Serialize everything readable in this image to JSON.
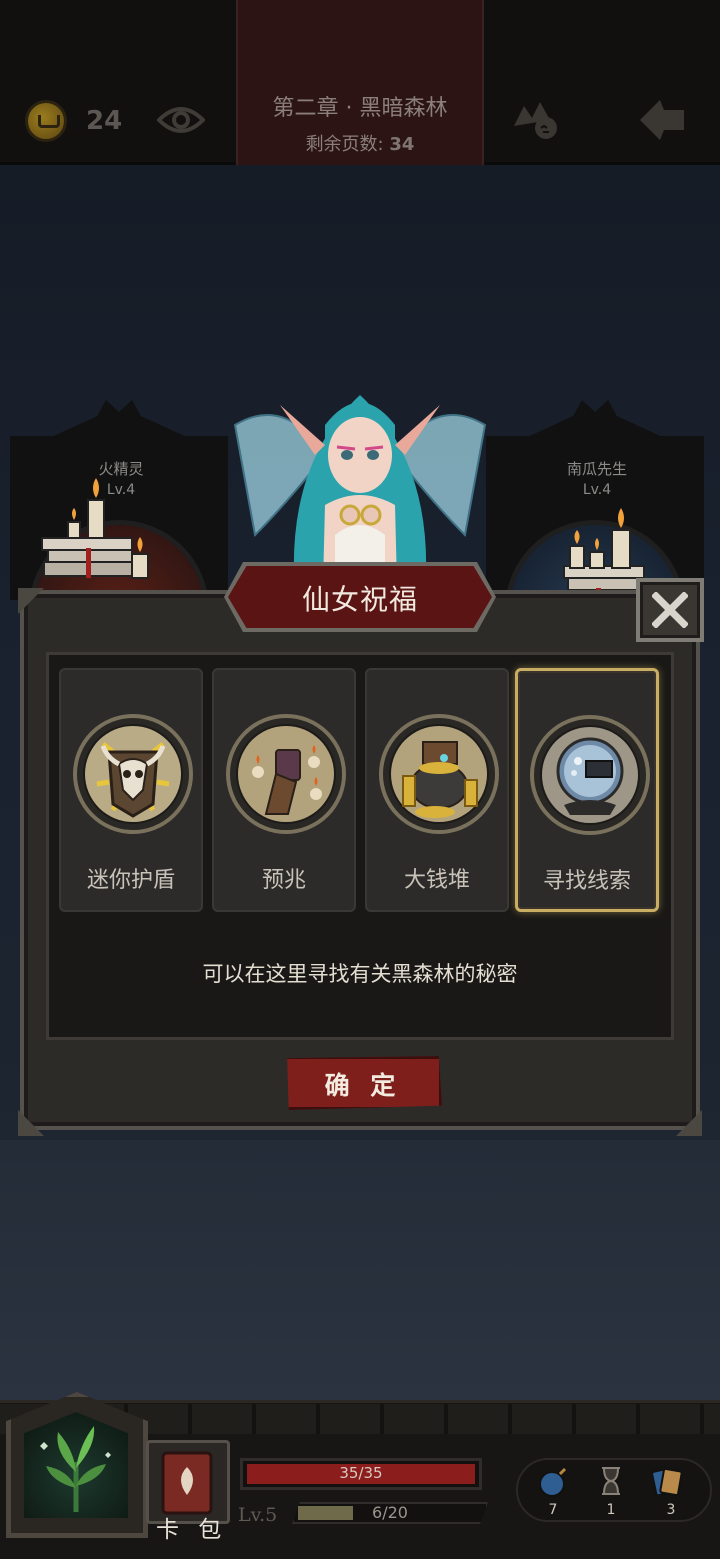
{
  "topbar": {
    "coins": "24",
    "chapter_title": "第二章 · 黑暗森林",
    "pages_label": "剩余页数:",
    "pages_value": "34"
  },
  "background_cards": [
    {
      "name": "火精灵",
      "level": "Lv.4"
    },
    {
      "name": "南瓜先生",
      "level": "Lv.4"
    }
  ],
  "modal": {
    "title": "仙女祝福",
    "options": [
      {
        "label": "迷你护盾",
        "icon": "shield-skull-icon",
        "selected": false
      },
      {
        "label": "预兆",
        "icon": "omen-cards-icon",
        "selected": false
      },
      {
        "label": "大钱堆",
        "icon": "treasure-pile-icon",
        "selected": false
      },
      {
        "label": "寻找线索",
        "icon": "crystal-ball-icon",
        "selected": true
      }
    ],
    "description": "可以在这里寻找有关黑森林的秘密",
    "confirm_label": "确 定"
  },
  "bottombar": {
    "cardpack_label": "卡 包",
    "hp_text": "35/35",
    "hp_fraction": 1.0,
    "level_text": "Lv.5",
    "xp_text": "6/20",
    "xp_fraction": 0.3,
    "resources": [
      {
        "icon": "bomb-icon",
        "count": "7"
      },
      {
        "icon": "hourglass-icon",
        "count": "1"
      },
      {
        "icon": "cards-icon",
        "count": "3"
      }
    ]
  },
  "colors": {
    "selected_border": "#c9ad63",
    "banner_red": "#5b1414",
    "confirm_red": "#7e1f1c",
    "hp_red": "#8b1d1d"
  }
}
